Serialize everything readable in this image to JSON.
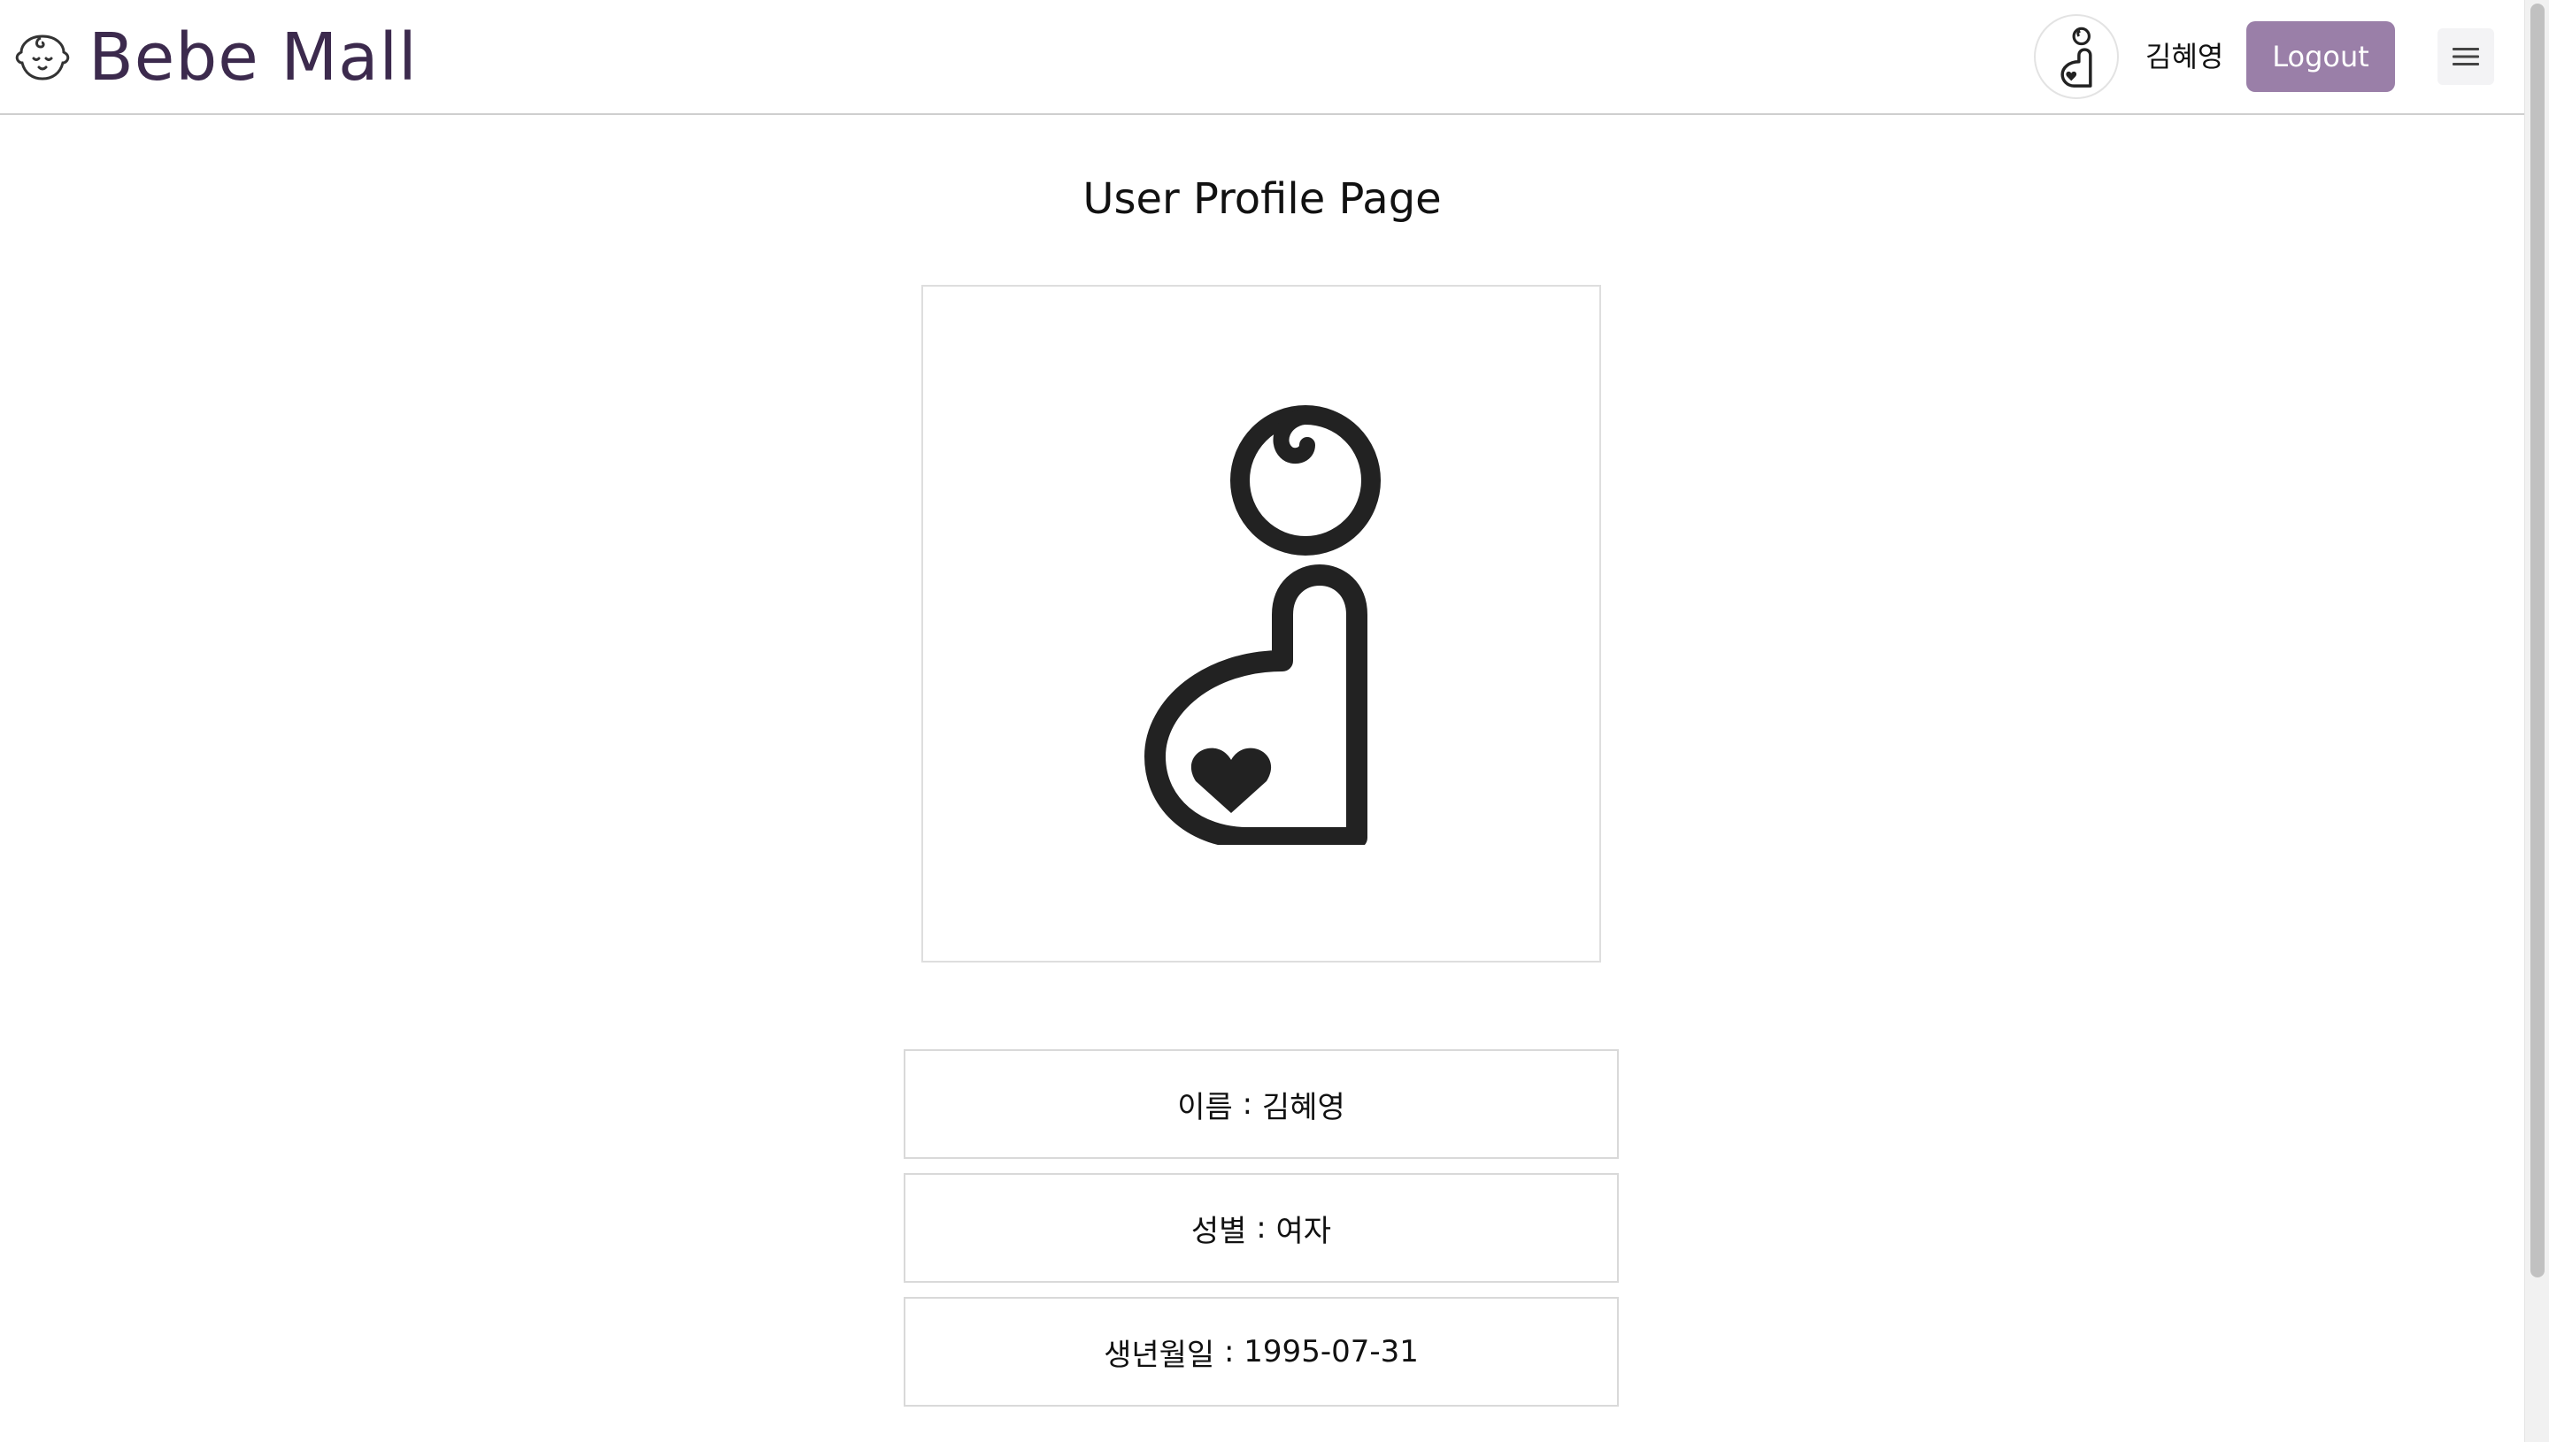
{
  "header": {
    "brand_name": "Bebe Mall",
    "brand_icon": "baby-face-icon",
    "avatar_icon": "mother-baby-icon",
    "username": "김혜영",
    "logout_label": "Logout",
    "menu_icon": "hamburger-menu-icon"
  },
  "main": {
    "title": "User Profile Page",
    "profile_image_icon": "mother-baby-icon",
    "fields": [
      {
        "label": "이름",
        "value": "김혜영"
      },
      {
        "label": "성별",
        "value": "여자"
      },
      {
        "label": "생년월일",
        "value": "1995-07-31"
      }
    ]
  },
  "colors": {
    "brand_text": "#3c2a4d",
    "logout_button": "#9a7fa8",
    "border": "#d9d9d9"
  }
}
